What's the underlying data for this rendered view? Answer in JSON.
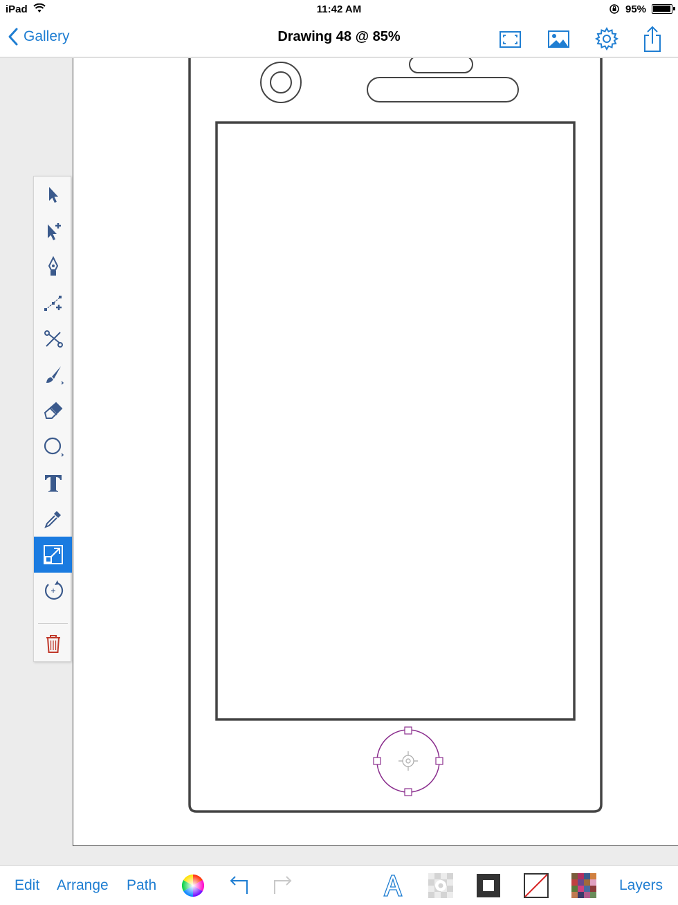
{
  "status_bar": {
    "device": "iPad",
    "time": "11:42 AM",
    "battery_percent": "95%",
    "battery_level": 0.95
  },
  "nav": {
    "back_label": "Gallery",
    "title": "Drawing 48 @ 85%",
    "icons": [
      "fullscreen-icon",
      "image-icon",
      "gear-icon",
      "share-icon"
    ]
  },
  "tools": [
    {
      "name": "select-tool",
      "icon": "arrow-icon",
      "active": false
    },
    {
      "name": "node-select-tool",
      "icon": "arrow-plus-icon",
      "active": false
    },
    {
      "name": "pen-tool",
      "icon": "pen-nib-icon",
      "active": false
    },
    {
      "name": "add-anchor-tool",
      "icon": "anchor-add-icon",
      "active": false
    },
    {
      "name": "scissors-tool",
      "icon": "scissors-icon",
      "active": false
    },
    {
      "name": "brush-tool",
      "icon": "brush-icon",
      "active": false
    },
    {
      "name": "eraser-tool",
      "icon": "eraser-icon",
      "active": false
    },
    {
      "name": "shape-tool",
      "icon": "circle-icon",
      "active": false
    },
    {
      "name": "text-tool",
      "icon": "text-T-icon",
      "active": false
    },
    {
      "name": "eyedropper-tool",
      "icon": "eyedropper-icon",
      "active": false
    },
    {
      "name": "scale-tool",
      "icon": "scale-icon",
      "active": true
    },
    {
      "name": "rotate-tool",
      "icon": "rotate-icon",
      "active": false
    },
    {
      "name": "delete-tool",
      "icon": "trash-icon",
      "active": false
    }
  ],
  "bottom_bar": {
    "edit": "Edit",
    "arrange": "Arrange",
    "path": "Path",
    "layers": "Layers"
  },
  "colors": {
    "accent": "#1f7ed2",
    "active_tool": "#1a7be0",
    "selection": "#8b2f8e",
    "stroke": "#444444",
    "trash": "#c0392b"
  }
}
